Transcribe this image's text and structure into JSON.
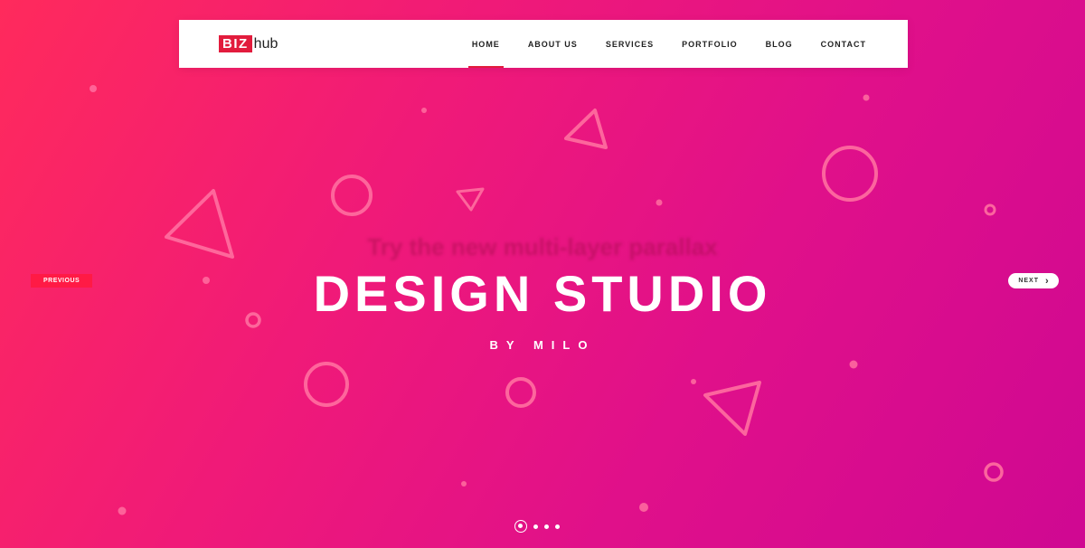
{
  "brand": {
    "biz": "BIZ",
    "hub": "hub"
  },
  "nav": {
    "items": [
      {
        "label": "HOME",
        "active": true
      },
      {
        "label": "ABOUT US",
        "active": false
      },
      {
        "label": "SERVICES",
        "active": false
      },
      {
        "label": "PORTFOLIO",
        "active": false
      },
      {
        "label": "BLOG",
        "active": false
      },
      {
        "label": "CONTACT",
        "active": false
      }
    ]
  },
  "hero": {
    "ghost_text": "Try the new multi-layer parallax",
    "title": "DESIGN STUDIO",
    "subtitle": "BY MILO"
  },
  "slider": {
    "previous_label": "PREVIOUS",
    "next_label": "NEXT",
    "next_icon": "chevron-right-icon",
    "slide_count": 4,
    "active_slide": 1
  },
  "colors": {
    "gradient_start": "#ff2a5c",
    "gradient_end": "#cf0892",
    "accent": "#e21c3d",
    "shape_stroke": "#ff6a9a"
  }
}
